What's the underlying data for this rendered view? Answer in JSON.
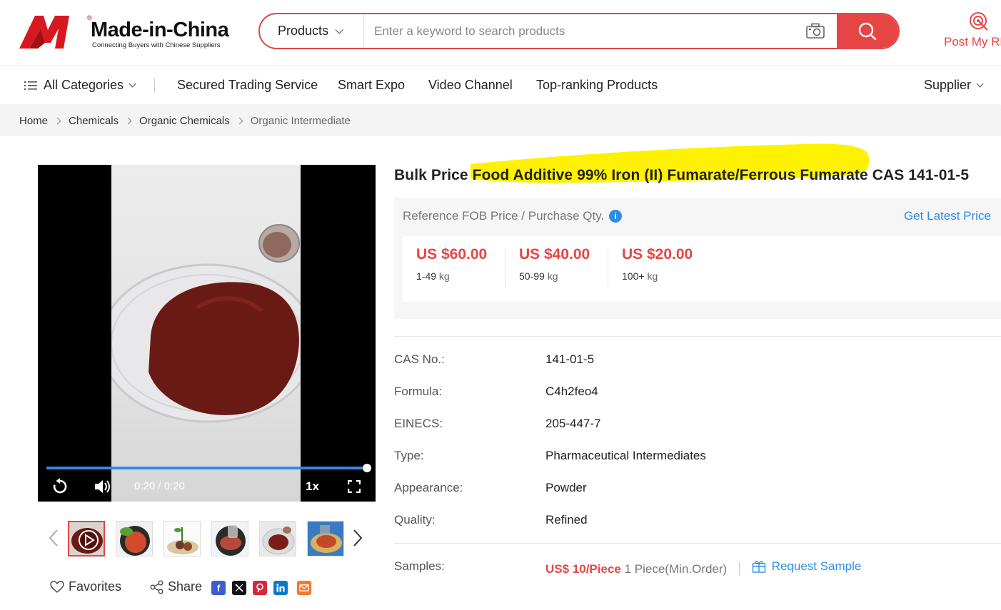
{
  "header": {
    "logo_name": "Made-in-China",
    "logo_tagline": "Connecting Buyers with Chinese Suppliers",
    "logo_reg": "®",
    "search_category": "Products",
    "search_placeholder": "Enter a keyword to search products",
    "post_label": "Post My RFQ"
  },
  "nav": {
    "all_categories": "All Categories",
    "items": [
      "Secured Trading Service",
      "Smart Expo",
      "Video Channel",
      "Top-ranking Products"
    ],
    "supplier": "Supplier"
  },
  "breadcrumb": [
    "Home",
    "Chemicals",
    "Organic Chemicals",
    "Organic Intermediate"
  ],
  "video": {
    "time": "0:20 / 0:20",
    "speed": "1x",
    "progress": 1.0
  },
  "thumbnails_count": 6,
  "social": {
    "favorites": "Favorites",
    "share": "Share"
  },
  "product": {
    "title": "Bulk Price Food Additive 99% Iron (II) Fumarate/Ferrous Fumarate CAS 141-01-5",
    "price_header": "Reference FOB Price / Purchase Qty.",
    "get_latest": "Get Latest Price",
    "tiers": [
      {
        "price": "US $60.00",
        "qty": "1-49",
        "unit": "kg"
      },
      {
        "price": "US $40.00",
        "qty": "50-99",
        "unit": "kg"
      },
      {
        "price": "US $20.00",
        "qty": "100+",
        "unit": "kg"
      }
    ],
    "specs": [
      {
        "key": "CAS No.:",
        "value": "141-01-5"
      },
      {
        "key": "Formula:",
        "value": "C4h2feo4"
      },
      {
        "key": "EINECS:",
        "value": "205-447-7"
      },
      {
        "key": "Type:",
        "value": "Pharmaceutical Intermediates"
      },
      {
        "key": "Appearance:",
        "value": "Powder"
      },
      {
        "key": "Quality:",
        "value": "Refined"
      }
    ],
    "samples": {
      "key": "Samples:",
      "price": "US$ 10/Piece",
      "min": "1 Piece(Min.Order)",
      "request": "Request Sample"
    }
  },
  "colors": {
    "brand_red": "#e64545",
    "link_blue": "#2d8de6",
    "highlight_yellow": "#fff200"
  }
}
